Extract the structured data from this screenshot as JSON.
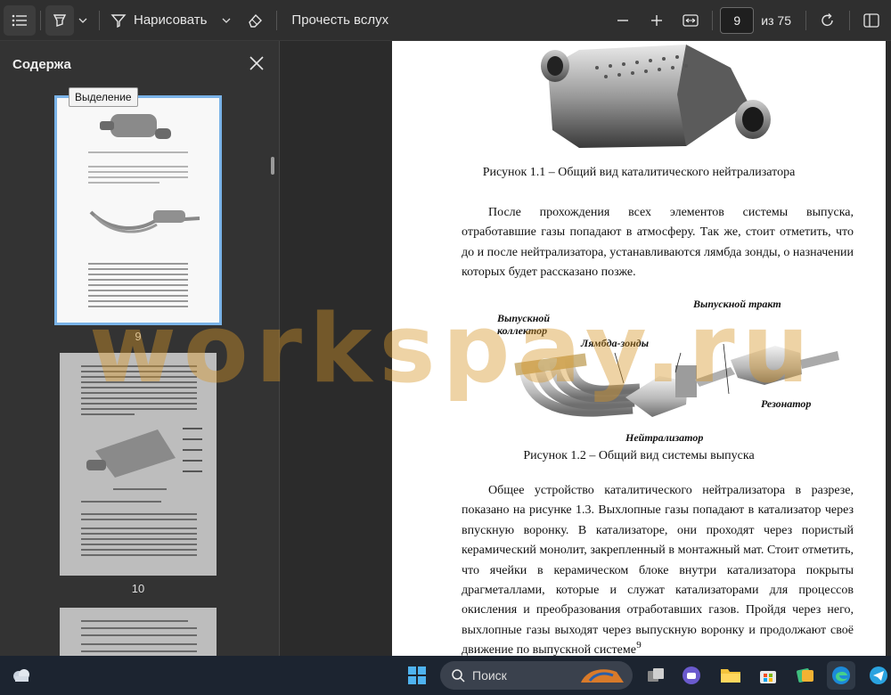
{
  "toolbar": {
    "draw_label": "Нарисовать",
    "read_aloud_label": "Прочесть вслух",
    "current_page": "9",
    "total_pages": "из 75"
  },
  "sidebar": {
    "title": "Содержа",
    "tooltip": "Выделение",
    "thumb_labels": [
      "9",
      "10"
    ]
  },
  "page": {
    "caption1": "Рисунок 1.1 – Общий вид каталитического нейтрализатора",
    "para1": "После прохождения всех элементов системы выпуска, отработавшие газы попадают в атмосферу. Так же, стоит отметить, что до и после нейтрализатора, устанавливаются лямбда зонды, о назначении которых будет рассказано позже.",
    "fig2_labels": {
      "collector": "Выпускной коллектор",
      "lambda": "Лямбда-зонды",
      "tract": "Выпускной тракт",
      "resonator": "Резонатор",
      "neutralizer": "Нейтрализатор"
    },
    "caption2": "Рисунок 1.2 – Общий вид системы выпуска",
    "para2": "Общее устройство каталитического нейтрализатора в разрезе, показано на рисунке 1.3. Выхлопные газы попадают в катализатор через впускную воронку. В катализаторе, они проходят через пористый керамический монолит, закрепленный в монтажный мат. Стоит отметить, что ячейки в керамическом блоке внутри катализатора покрыты драгметаллами, которые и служат катализаторами для процессов окисления и преобразования отработавших газов. Пройдя через него, выхлопные газы выходят через выпускную воронку и продолжают своё движение по выпускной системе",
    "page_number": "9"
  },
  "watermark": "workspay.ru",
  "taskbar": {
    "search_label": "Поиск"
  }
}
